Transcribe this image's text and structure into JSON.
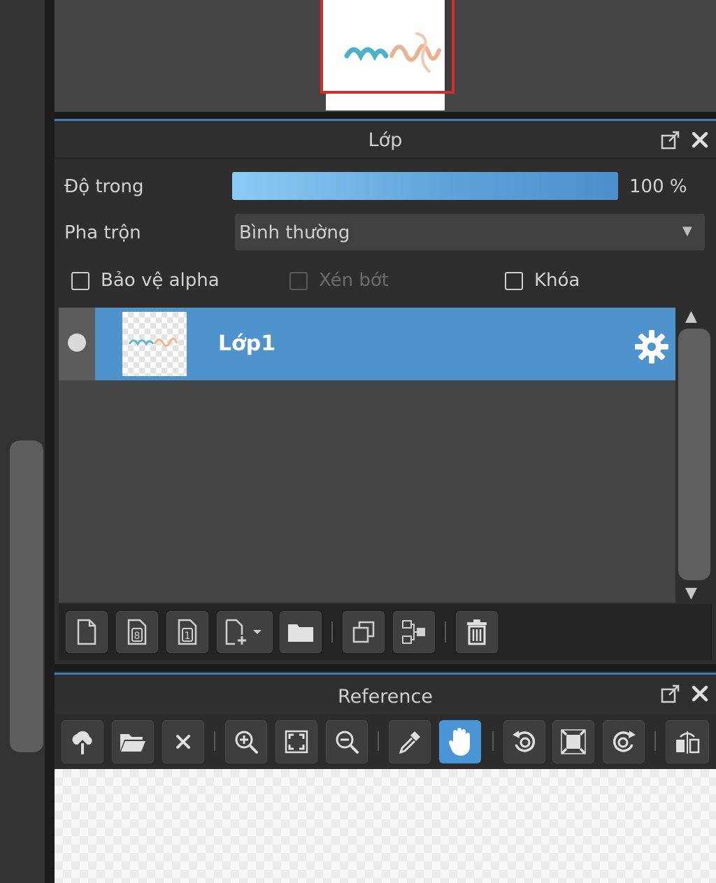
{
  "navigator": {
    "thumbnail_art_text": "mây"
  },
  "layer_panel": {
    "title": "Lớp",
    "opacity_label": "Độ trong",
    "opacity_value": "100 %",
    "opacity_level": 1.0,
    "blend_label": "Pha trộn",
    "blend_value": "Bình thường",
    "checkboxes": {
      "protect_alpha": "Bảo vệ alpha",
      "clip": "Xén bớt",
      "lock": "Khóa"
    },
    "layers": [
      {
        "name": "Lớp1",
        "selected": true,
        "visible": true
      }
    ],
    "toolbar_icons": [
      "new-layer-icon",
      "new-8bit-layer-icon",
      "new-1bit-layer-icon",
      "new-layer-dropdown-icon",
      "folder-icon",
      "duplicate-icon",
      "merge-down-icon",
      "delete-icon"
    ]
  },
  "reference_panel": {
    "title": "Reference",
    "toolbar_icons": [
      "upload-icon",
      "open-folder-icon",
      "close-icon",
      "zoom-in-icon",
      "fit-icon",
      "zoom-out-icon",
      "eyedropper-icon",
      "hand-icon",
      "rotate-left-icon",
      "fit-window-icon",
      "rotate-right-icon",
      "flip-icon"
    ],
    "active_tool": "hand-icon"
  },
  "colors": {
    "accent_blue": "#4f93cd",
    "viewport_red": "#d42b2b",
    "panel_bg": "#2e2e2e",
    "list_bg": "#454545"
  }
}
